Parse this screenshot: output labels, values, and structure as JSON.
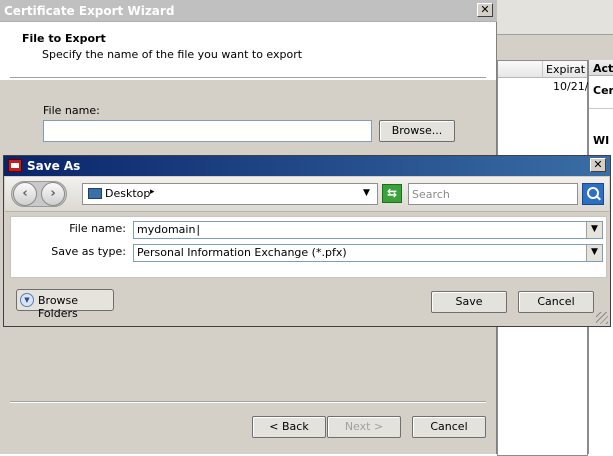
{
  "background_window": {
    "col_expiration": "Expirat",
    "row_expiration_value": "10/21/",
    "actions_header": "Act",
    "actions_item_1": "Cer",
    "actions_item_2": "WI"
  },
  "wizard": {
    "title": "Certificate Export Wizard",
    "close_label": "✕",
    "header_title": "File to Export",
    "header_subtitle": "Specify the name of the file you want to export",
    "file_name_label": "File name:",
    "file_name_value": "",
    "browse_label": "Browse...",
    "back_label": "< Back",
    "next_label": "Next >",
    "cancel_label": "Cancel"
  },
  "save_as": {
    "title": "Save As",
    "close_label": "✕",
    "back_arrow": "‹",
    "forward_arrow": "›",
    "location": "Desktop",
    "location_chevron": "▸",
    "dropdown_arrow": "▼",
    "search_placeholder": "Search",
    "file_name_label": "File name:",
    "file_name_value": "mydomain",
    "save_type_label": "Save as type:",
    "save_type_value": "Personal Information Exchange (*.pfx)",
    "browse_folders_label": "Browse Folders",
    "browse_folders_arrow": "▼",
    "save_label": "Save",
    "cancel_label": "Cancel"
  },
  "colors": {
    "active_title_start": "#0a246a",
    "active_title_end": "#3a6ea5",
    "inactive_title": "#c0c0c0",
    "dialog_face": "#d4d0c8"
  },
  "icons": [
    "close-icon",
    "back-arrow-icon",
    "forward-arrow-icon",
    "desktop-icon",
    "refresh-icon",
    "search-icon",
    "expand-icon",
    "dropdown-arrow-icon",
    "app-icon",
    "resize-grip-icon"
  ]
}
